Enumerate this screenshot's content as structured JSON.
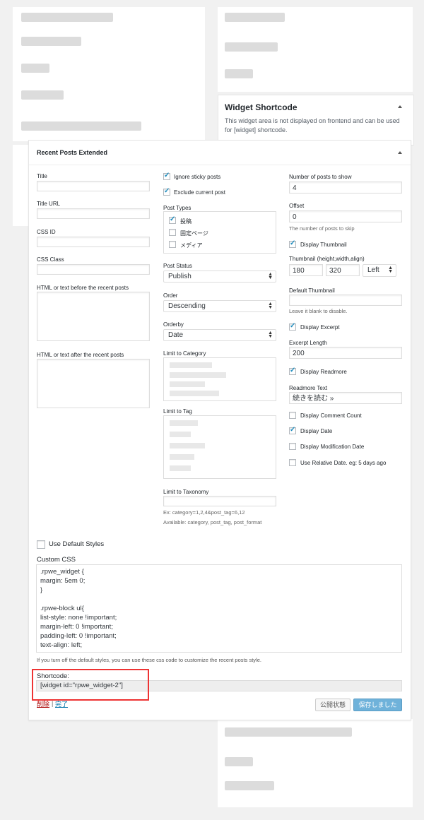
{
  "widget_shortcode": {
    "title": "Widget Shortcode",
    "description": "This widget area is not displayed on frontend and can be used for [widget] shortcode."
  },
  "panel": {
    "title": "Recent Posts Extended",
    "col1": {
      "title_label": "Title",
      "title_url_label": "Title URL",
      "css_id_label": "CSS ID",
      "css_class_label": "CSS Class",
      "before_label": "HTML or text before the recent posts",
      "after_label": "HTML or text after the recent posts"
    },
    "col2": {
      "ignore_sticky": "Ignore sticky posts",
      "exclude_current": "Exclude current post",
      "post_types_label": "Post Types",
      "post_types": [
        "投稿",
        "固定ページ",
        "メディア"
      ],
      "post_status_label": "Post Status",
      "post_status_value": "Publish",
      "order_label": "Order",
      "order_value": "Descending",
      "orderby_label": "Orderby",
      "orderby_value": "Date",
      "limit_category_label": "Limit to Category",
      "limit_tag_label": "Limit to Tag",
      "limit_taxonomy_label": "Limit to Taxonomy",
      "taxonomy_hint1": "Ex: category=1,2,4&post_tag=6,12",
      "taxonomy_hint2": "Available: category, post_tag, post_format"
    },
    "col3": {
      "num_posts_label": "Number of posts to show",
      "num_posts_value": "4",
      "offset_label": "Offset",
      "offset_value": "0",
      "offset_hint": "The number of posts to skip",
      "display_thumbnail": "Display Thumbnail",
      "thumb_label": "Thumbnail (height,width,align)",
      "thumb_height": "180",
      "thumb_width": "320",
      "thumb_align": "Left",
      "default_thumb_label": "Default Thumbnail",
      "default_thumb_hint": "Leave it blank to disable.",
      "display_excerpt": "Display Excerpt",
      "excerpt_length_label": "Excerpt Length",
      "excerpt_length_value": "200",
      "display_readmore": "Display Readmore",
      "readmore_text_label": "Readmore Text",
      "readmore_text_value": "続きを読む »",
      "display_comment_count": "Display Comment Count",
      "display_date": "Display Date",
      "display_mod_date": "Display Modification Date",
      "use_relative_date": "Use Relative Date. eg: 5 days ago"
    },
    "use_default_styles": "Use Default Styles",
    "custom_css_label": "Custom CSS",
    "custom_css_lines": [
      ".rpwe_widget {",
      "margin: 5em 0;",
      "}",
      "",
      ".rpwe-block ul{",
      "list-style: none !important;",
      "margin-left: 0 !important;",
      "padding-left: 0 !important;",
      "text-align: left;"
    ],
    "css_hint": "If you turn off the default styles, you can use these css code to customize the recent posts style.",
    "shortcode_label": "Shortcode:",
    "shortcode_value": "[widget id=\"rpwe_widget-2\"]",
    "delete_link": "削除",
    "separator": "|",
    "done_link": "完了",
    "visibility_button": "公開状態",
    "save_button": "保存しました"
  },
  "colors": {
    "accent": "#0073aa",
    "highlight_border": "#ee3333",
    "primary_button": "#6fb2da",
    "delete_link": "#a00000"
  }
}
